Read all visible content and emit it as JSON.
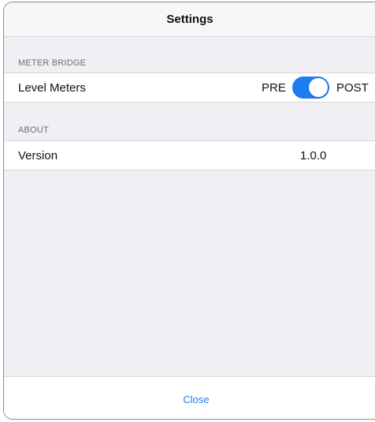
{
  "navbar": {
    "title": "Settings"
  },
  "sections": {
    "meter_bridge": {
      "header": "METER BRIDGE",
      "level_meters": {
        "label": "Level Meters",
        "left_option": "PRE",
        "right_option": "POST",
        "toggle_on": true
      }
    },
    "about": {
      "header": "ABOUT",
      "version": {
        "label": "Version",
        "value": "1.0.0"
      }
    }
  },
  "footer": {
    "close_label": "Close"
  },
  "colors": {
    "accent": "#1e7cf2",
    "background": "#efeff4",
    "cell": "#ffffff",
    "separator": "#d8d8dc",
    "secondary_text": "#6d6d72"
  },
  "icons": {
    "toggle": "switch-toggle"
  }
}
